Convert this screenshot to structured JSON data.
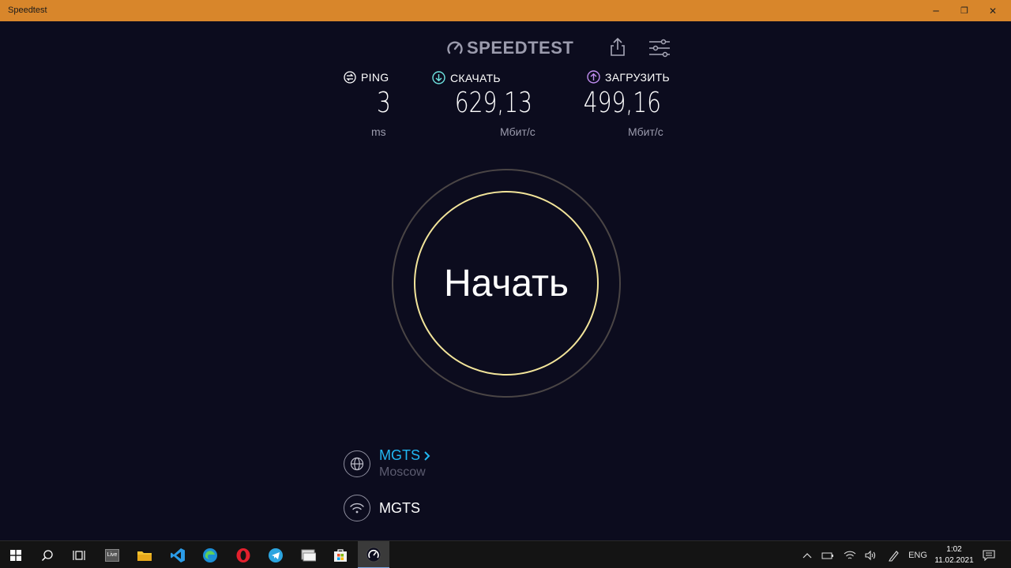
{
  "window": {
    "title": "Speedtest",
    "minimize_glyph": "─",
    "restore_glyph": "❐",
    "close_glyph": "✕"
  },
  "header": {
    "logo_text": "SPEEDTEST",
    "logo_icon": "gauge-icon",
    "share_icon": "share-icon",
    "settings_icon": "sliders-icon"
  },
  "metrics": {
    "ping": {
      "label": "PING",
      "value": "3",
      "unit": "ms",
      "icon": "ping-icon"
    },
    "download": {
      "label": "СКАЧАТЬ",
      "value": "629,13",
      "unit": "Мбит/с",
      "icon": "download-arrow-icon",
      "color": "#6ee3e0"
    },
    "upload": {
      "label": "ЗАГРУЗИТЬ",
      "value": "499,16",
      "unit": "Мбит/с",
      "icon": "upload-arrow-icon",
      "color": "#c08df0"
    }
  },
  "go_button": {
    "label": "Начать",
    "ring_color": "#f2e49a"
  },
  "provider": {
    "isp_name": "MGTS",
    "isp_location": "Moscow",
    "isp_color": "#21b7f2",
    "connection_name": "MGTS"
  },
  "taskbar": {
    "apps": [
      "windows-start",
      "search",
      "task-view",
      "live-app",
      "file-explorer",
      "vscode",
      "edge",
      "opera",
      "telegram",
      "app-window",
      "store",
      "speedtest"
    ],
    "live_label": "Live",
    "language": "ENG",
    "time": "1:02",
    "date": "11.02.2021"
  }
}
